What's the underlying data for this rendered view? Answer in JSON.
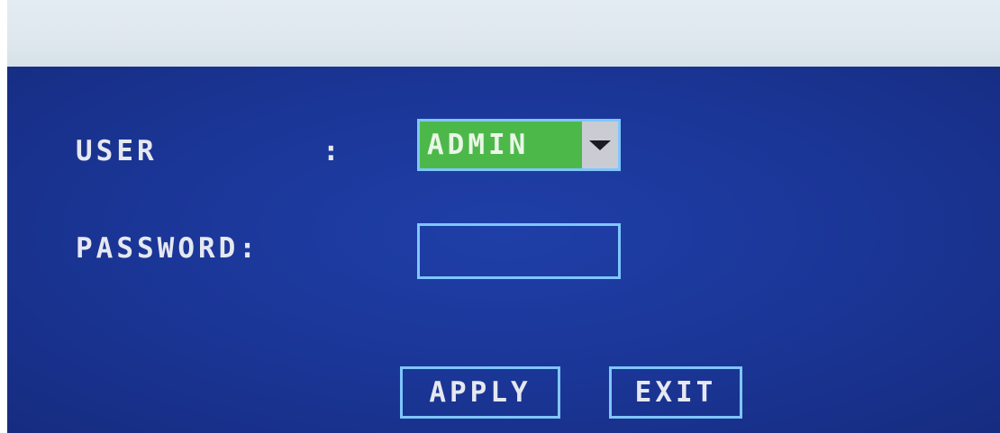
{
  "login": {
    "user_label": "USER",
    "user_colon": ":",
    "password_label": "PASSWORD:",
    "user_value": "ADMIN",
    "password_value": "",
    "apply_label": "APPLY",
    "exit_label": "EXIT"
  },
  "icons": {
    "dropdown": "chevron-down-icon"
  },
  "colors": {
    "panel_background": "#1a3595",
    "field_border": "#7fc6ff",
    "selected_highlight": "#4db84a",
    "text": "#e6e8f0"
  }
}
